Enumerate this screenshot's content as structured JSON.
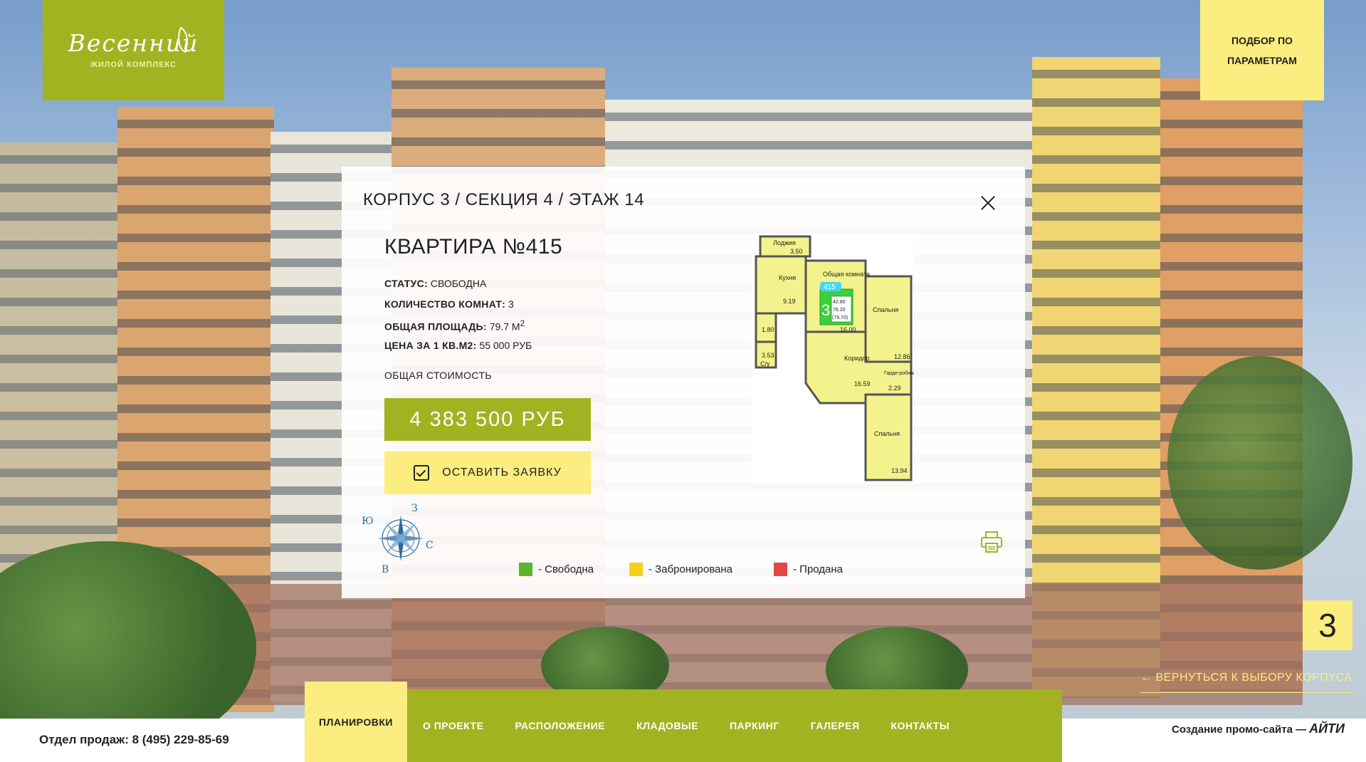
{
  "logo": {
    "name": "Весенний",
    "subtitle": "ЖИЛОЙ КОМПЛЕКС"
  },
  "filter_button": {
    "label": "ПОДБОР ПО\nПАРАМЕТРАМ"
  },
  "modal": {
    "title": "КОРПУС 3 / СЕКЦИЯ 4 / ЭТАЖ 14",
    "apartment_title": "КВАРТИРА №415",
    "facts": [
      {
        "label": "Статус:",
        "value": "СВОБОДНА"
      },
      {
        "label": "Количество комнат:",
        "value": "3"
      },
      {
        "label": "Общая площадь:",
        "value": "79.7 М",
        "sup": "2"
      },
      {
        "label": "Цена за 1 кв.м2:",
        "value": "55 000 РУБ"
      }
    ],
    "total_label": "ОБЩАЯ СТОИМОСТЬ",
    "price": "4 383 500 РУБ",
    "apply_label": "ОСТАВИТЬ ЗАЯВКУ",
    "compass": {
      "n": "З",
      "w": "Ю",
      "e": "С",
      "s": "В"
    },
    "legend": [
      {
        "label": "- Свободна",
        "color": "#5bb52f"
      },
      {
        "label": "- Забронирована",
        "color": "#f2d21b"
      },
      {
        "label": "- Продана",
        "color": "#e04848"
      }
    ],
    "floor_plan": {
      "rooms": [
        {
          "name": "Лоджия",
          "area": "3.50"
        },
        {
          "name": "Кухня",
          "area": "9.19"
        },
        {
          "name": "Общая комната",
          "area": "16.00"
        },
        {
          "name": "Спальня",
          "area": "12.86"
        },
        {
          "name": "Коридор",
          "area": "16.59"
        },
        {
          "name": "Гарде-робная",
          "area": "2.29"
        },
        {
          "name": "Спальня",
          "area": "13.94"
        },
        {
          "name": "С/у",
          "area": "3.53"
        },
        {
          "name": "",
          "area": "1.80"
        }
      ],
      "apt_number": "415",
      "rooms_count": "3",
      "areas": [
        "42.80",
        "76.20",
        "(79.70)"
      ]
    }
  },
  "corpus_badge": "3",
  "back_link": "← ВЕРНУТЬСЯ К ВЫБОРУ КОРПУСА",
  "footer": {
    "sales": "Отдел продаж: 8 (495) 229-85-69",
    "promo": "Создание промо-сайта —",
    "promo_brand": "АЙТИ"
  },
  "nav": [
    {
      "label": "ПЛАНИРОВКИ",
      "active": true
    },
    {
      "label": "О ПРОЕКТЕ"
    },
    {
      "label": "РАСПОЛОЖЕНИЕ"
    },
    {
      "label": "КЛАДОВЫЕ"
    },
    {
      "label": "ПАРКИНГ"
    },
    {
      "label": "ГАЛЕРЕЯ"
    },
    {
      "label": "КОНТАКТЫ"
    }
  ]
}
